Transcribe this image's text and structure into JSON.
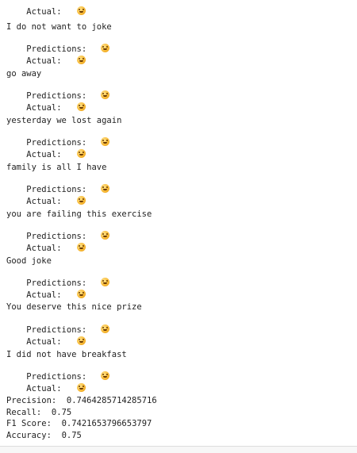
{
  "labels": {
    "predictions": "Predictions:",
    "actual": "Actual:"
  },
  "emoji": {
    "smile": "😄",
    "disappointed": "😞",
    "heart": "❤️",
    "baseball": "⚾",
    "fork_and_knife": "🍴"
  },
  "top_partial": {
    "actual_emoji": "smile"
  },
  "samples": [
    {
      "text": "I do not want to joke",
      "prediction": "disappointed",
      "actual": "disappointed"
    },
    {
      "text": "go away",
      "prediction": "disappointed",
      "actual": "disappointed"
    },
    {
      "text": "yesterday we lost again",
      "prediction": "smile",
      "actual": "disappointed"
    },
    {
      "text": "family is all I have",
      "prediction": "disappointed",
      "actual": "smile"
    },
    {
      "text": "you are failing this exercise",
      "prediction": "disappointed",
      "actual": "disappointed"
    },
    {
      "text": "Good joke",
      "prediction": "smile",
      "actual": "smile"
    },
    {
      "text": "You deserve this nice prize",
      "prediction": "disappointed",
      "actual": "smile"
    },
    {
      "text": "I did not have breakfast",
      "prediction": "disappointed",
      "actual": "smile"
    }
  ],
  "metrics": {
    "precision_label": "Precision:",
    "precision_value": "0.7464285714285716",
    "recall_label": "Recall:",
    "recall_value": "0.75",
    "f1_label": "F1 Score:",
    "f1_value": "0.7421653796653797",
    "accuracy_label": "Accuracy:",
    "accuracy_value": "0.75"
  }
}
